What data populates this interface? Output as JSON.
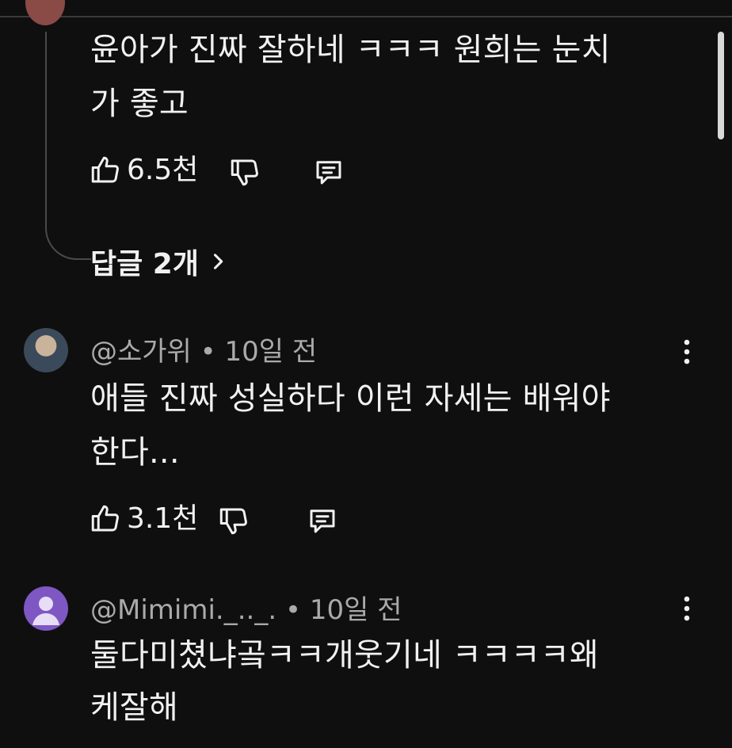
{
  "comments": [
    {
      "text_line1": "윤아가 진짜 잘하네 ㅋㅋㅋ 원희는 눈치",
      "text_line2": "가 좋고",
      "likes": "6.5천",
      "replies_label": "답글 2개"
    },
    {
      "author": "@소가위",
      "age": "10일 전",
      "text_line1": "애들 진짜 성실하다 이런 자세는 배워야",
      "text_line2": "한다...",
      "likes": "3.1천"
    },
    {
      "author": "@Mimimi._.._.",
      "age": "10일 전",
      "text_line1": "둘다미쳤냐곸ㅋㅋ개웃기네 ㅋㅋㅋㅋ왜",
      "text_line2": "케잘해"
    }
  ],
  "separator": "•",
  "icons": [
    "like-icon",
    "dislike-icon",
    "reply-icon",
    "more-icon",
    "chevron-right-icon",
    "avatar-default-icon"
  ],
  "colors": {
    "background": "#0f0f0f",
    "text": "#f1f1f1",
    "meta": "#aaaaaa",
    "default_avatar": "#7e57c2"
  }
}
